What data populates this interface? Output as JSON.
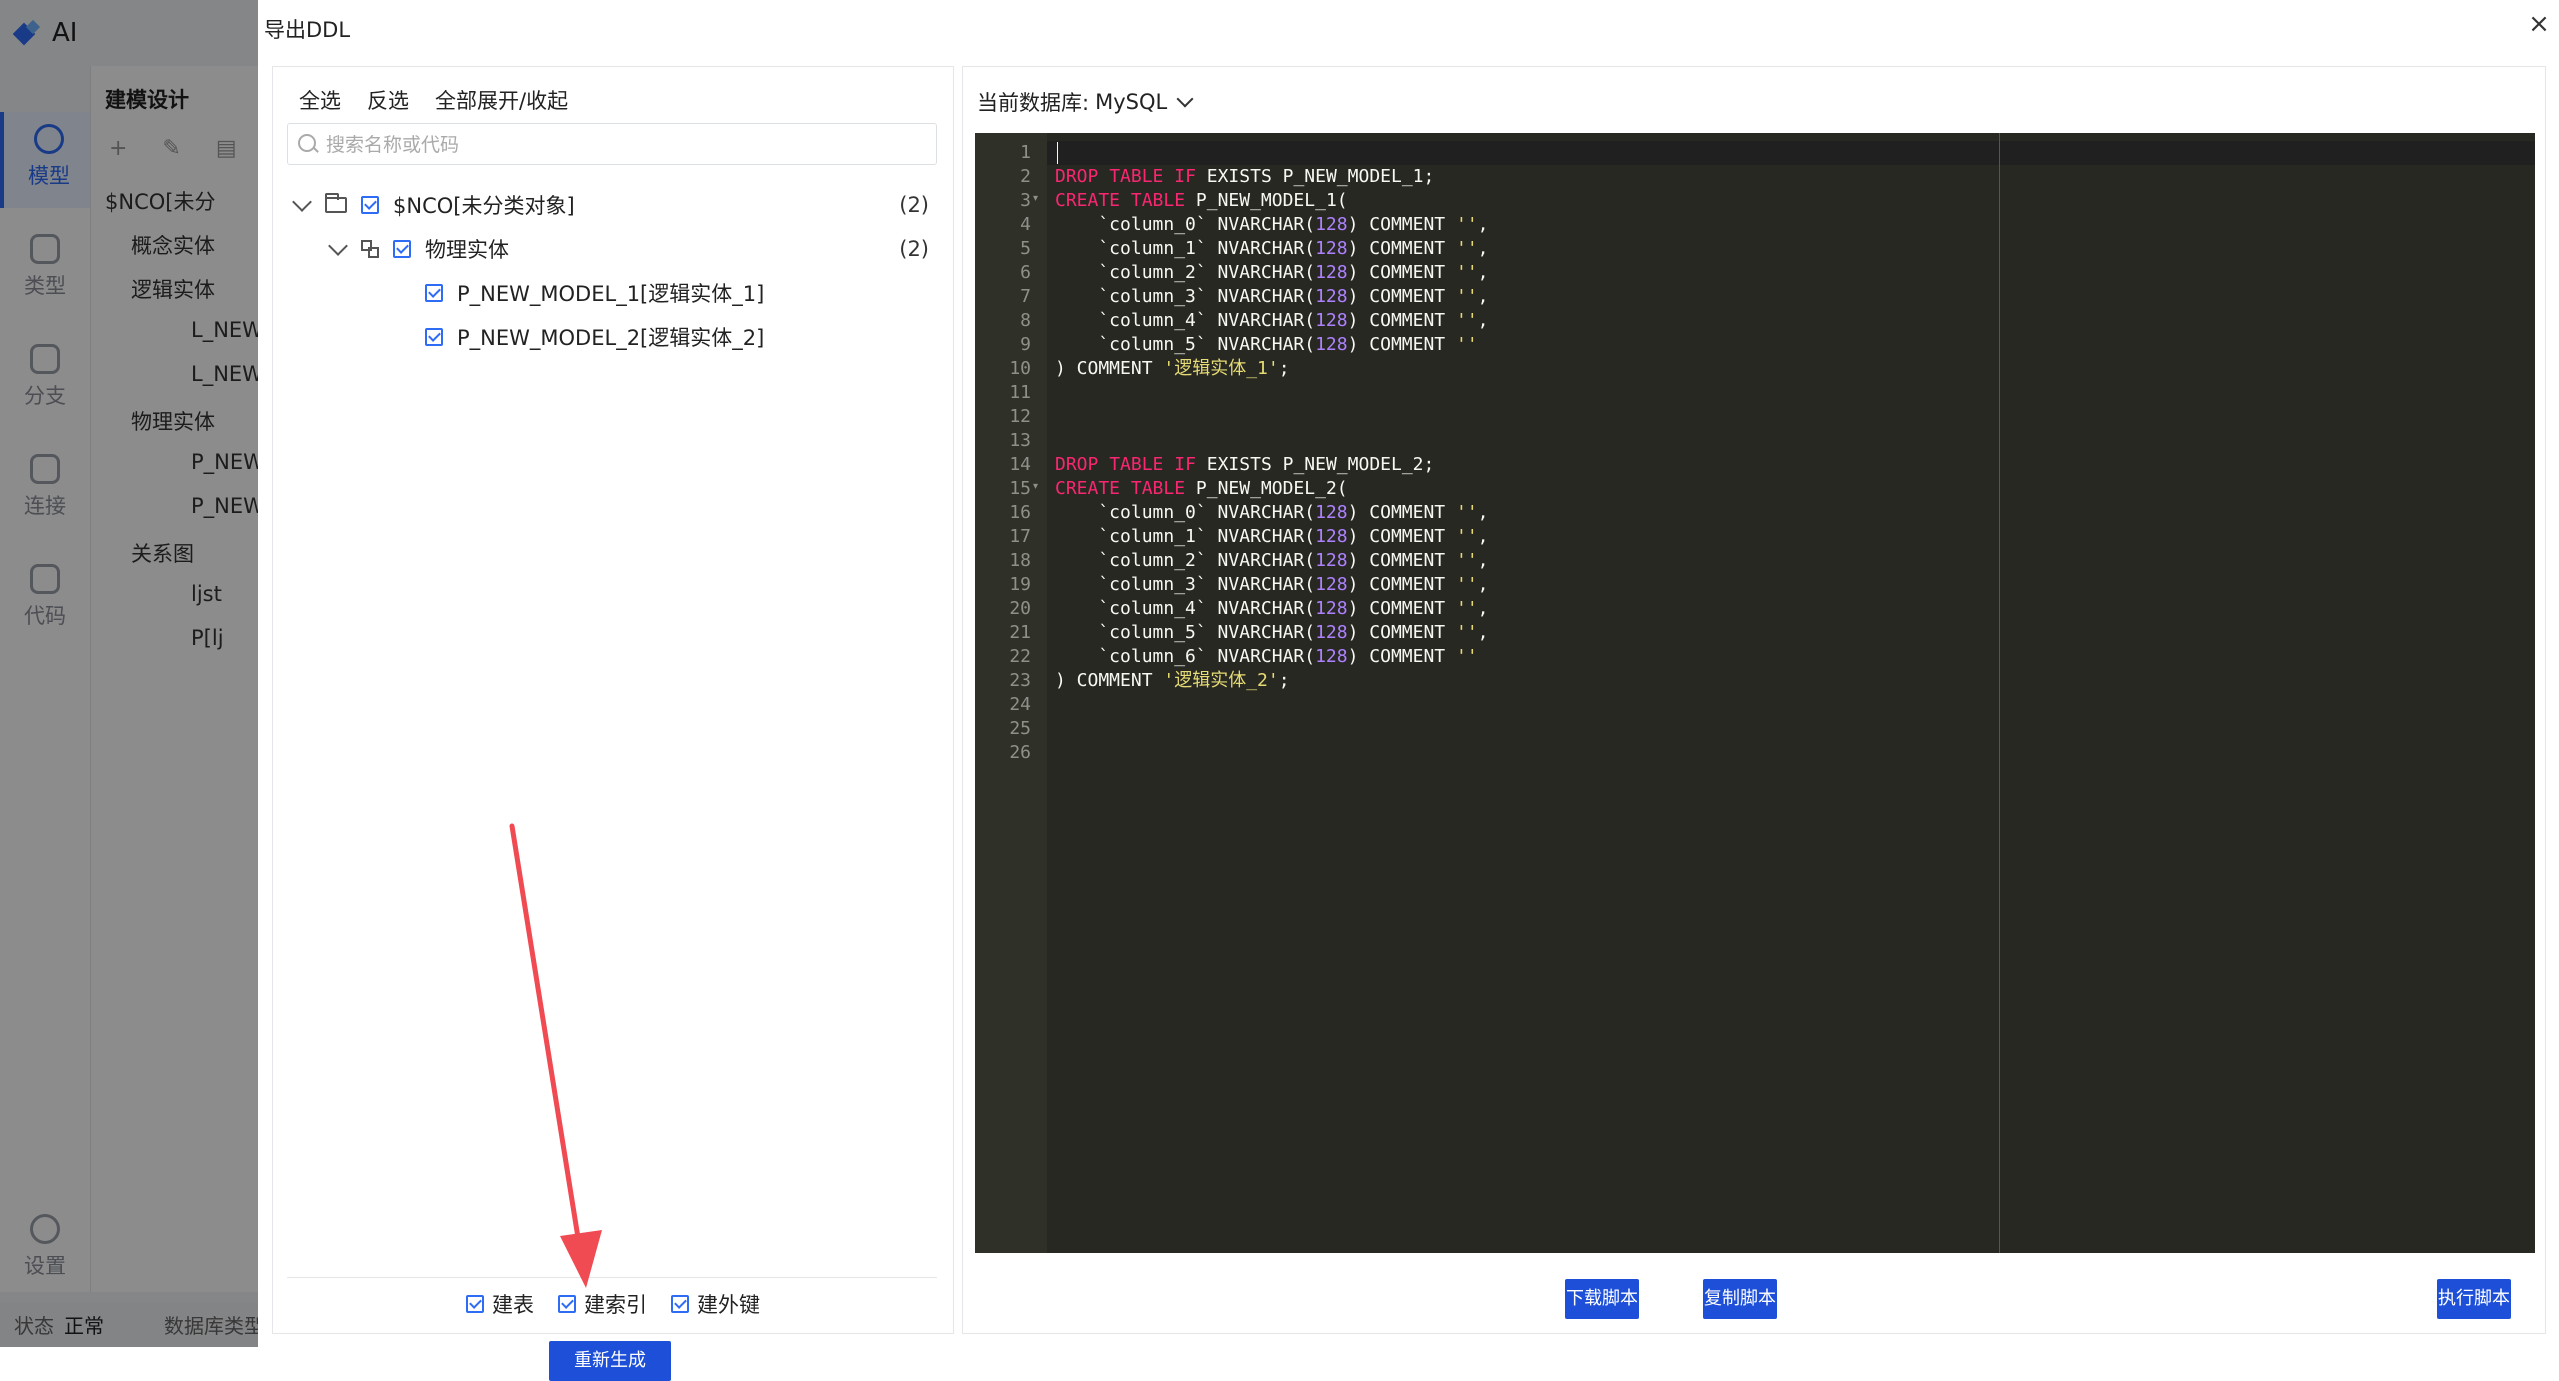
{
  "app": {
    "name": "AI",
    "rail": [
      {
        "label": "模型",
        "active": true
      },
      {
        "label": "类型",
        "active": false
      },
      {
        "label": "分支",
        "active": false
      },
      {
        "label": "连接",
        "active": false
      },
      {
        "label": "代码",
        "active": false
      },
      {
        "label": "设置",
        "active": false
      }
    ],
    "panel_title": "建模设计",
    "tree": [
      "$NCO[未分",
      "概念实体",
      "逻辑实体",
      "L_NEW",
      "L_NEW",
      "物理实体",
      "P_NEW",
      "P_NEW",
      "关系图",
      "ljst",
      "P[lj"
    ],
    "status_label": "状态",
    "status_value": "正常",
    "db_type_label": "数据库类型"
  },
  "dialog": {
    "title": "导出DDL",
    "close": "×",
    "actions": {
      "select_all": "全选",
      "invert": "反选",
      "expand_collapse": "全部展开/收起"
    },
    "search": {
      "placeholder": "搜索名称或代码",
      "value": ""
    },
    "tree": {
      "root": {
        "label": "$NCO[未分类对象]",
        "count": "(2)"
      },
      "group": {
        "label": "物理实体",
        "count": "(2)"
      },
      "items": [
        {
          "label": "P_NEW_MODEL_1[逻辑实体_1]"
        },
        {
          "label": "P_NEW_MODEL_2[逻辑实体_2]"
        }
      ]
    },
    "options": {
      "create_table": "建表",
      "create_index": "建索引",
      "create_fk": "建外键"
    },
    "regenerate": "重新生成",
    "db_label": "当前数据库:",
    "db_value": "MySQL",
    "buttons": {
      "download": "下载脚本",
      "copy": "复制脚本",
      "execute": "执行脚本"
    },
    "code": {
      "colors": {
        "background": "#272822",
        "keyword": "#f92672",
        "string": "#e6db74",
        "number": "#ae81ff",
        "text": "#f8f8f2"
      },
      "lines": [
        "",
        "DROP TABLE IF EXISTS P_NEW_MODEL_1;",
        "CREATE TABLE P_NEW_MODEL_1(",
        "    `column_0` NVARCHAR(128) COMMENT '',",
        "    `column_1` NVARCHAR(128) COMMENT '',",
        "    `column_2` NVARCHAR(128) COMMENT '',",
        "    `column_3` NVARCHAR(128) COMMENT '',",
        "    `column_4` NVARCHAR(128) COMMENT '',",
        "    `column_5` NVARCHAR(128) COMMENT ''",
        ") COMMENT '逻辑实体_1';",
        "",
        "",
        "",
        "DROP TABLE IF EXISTS P_NEW_MODEL_2;",
        "CREATE TABLE P_NEW_MODEL_2(",
        "    `column_0` NVARCHAR(128) COMMENT '',",
        "    `column_1` NVARCHAR(128) COMMENT '',",
        "    `column_2` NVARCHAR(128) COMMENT '',",
        "    `column_3` NVARCHAR(128) COMMENT '',",
        "    `column_4` NVARCHAR(128) COMMENT '',",
        "    `column_5` NVARCHAR(128) COMMENT '',",
        "    `column_6` NVARCHAR(128) COMMENT ''",
        ") COMMENT '逻辑实体_2';",
        "",
        "",
        ""
      ]
    },
    "annotation_arrow_color": "#f04a52"
  }
}
